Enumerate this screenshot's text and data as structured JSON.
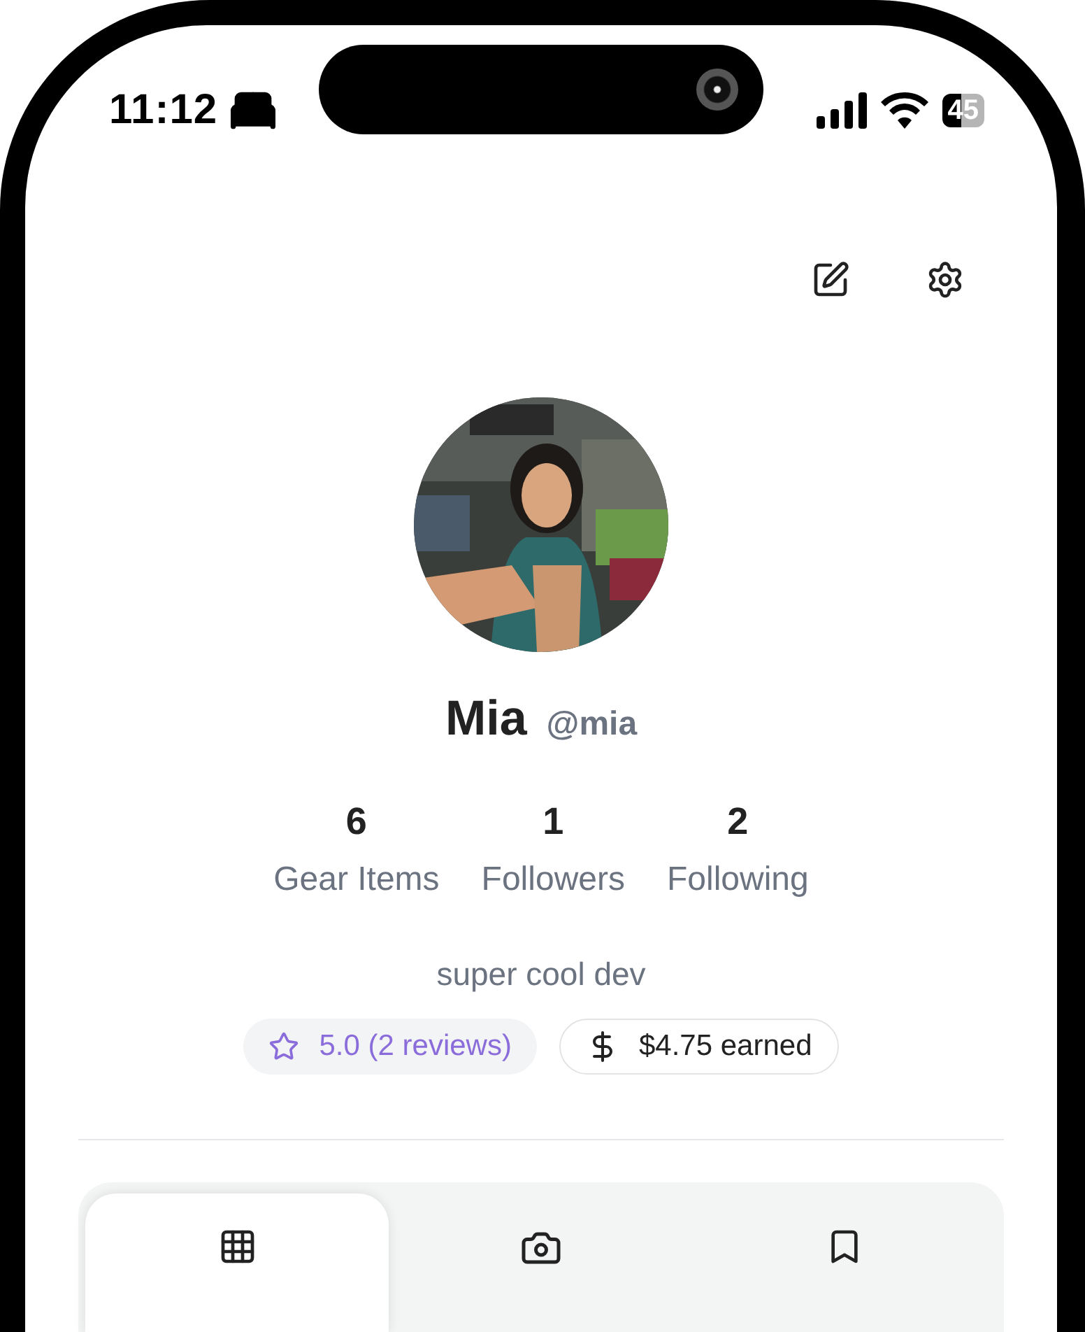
{
  "status_bar": {
    "time": "11:12",
    "battery": "45"
  },
  "profile": {
    "name": "Mia",
    "handle": "@mia",
    "bio": "super cool dev"
  },
  "stats": [
    {
      "value": "6",
      "label": "Gear Items"
    },
    {
      "value": "1",
      "label": "Followers"
    },
    {
      "value": "2",
      "label": "Following"
    }
  ],
  "badges": [
    {
      "kind": "rating",
      "text": "5.0 (2 reviews)"
    },
    {
      "kind": "earnings",
      "text": "$4.75 earned"
    }
  ],
  "tabs": [
    {
      "kind": "grid",
      "selected": true
    },
    {
      "kind": "camera",
      "selected": false
    },
    {
      "kind": "bookmark",
      "selected": false
    }
  ]
}
